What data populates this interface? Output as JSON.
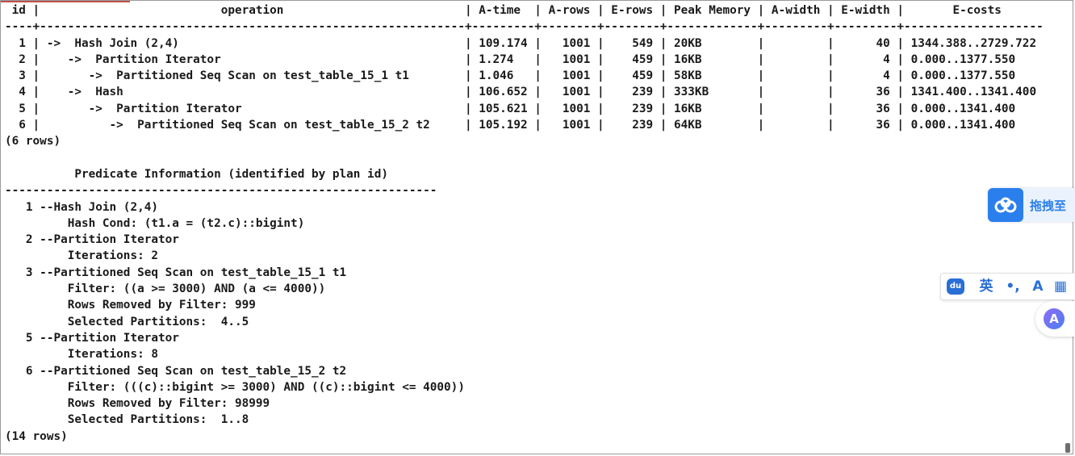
{
  "terminal": {
    "lines": [
      " id |                          operation                          | A-time  | A-rows | E-rows | Peak Memory | A-width | E-width |       E-costs",
      "----+-------------------------------------------------------------+---------+--------+--------+-------------+---------+---------+--------------------",
      "  1 | ->  Hash Join (2,4)                                         | 109.174 |   1001 |    549 | 20KB        |         |      40 | 1344.388..2729.722",
      "  2 |    ->  Partition Iterator                                   | 1.274   |   1001 |    459 | 16KB        |         |       4 | 0.000..1377.550",
      "  3 |       ->  Partitioned Seq Scan on test_table_15_1 t1        | 1.046   |   1001 |    459 | 58KB        |         |       4 | 0.000..1377.550",
      "  4 |    ->  Hash                                                 | 106.652 |   1001 |    239 | 333KB       |         |      36 | 1341.400..1341.400",
      "  5 |       ->  Partition Iterator                                | 105.621 |   1001 |    239 | 16KB        |         |      36 | 0.000..1341.400",
      "  6 |          ->  Partitioned Seq Scan on test_table_15_2 t2     | 105.192 |   1001 |    239 | 64KB        |         |      36 | 0.000..1341.400",
      "(6 rows)",
      "",
      "          Predicate Information (identified by plan id)",
      "--------------------------------------------------------------",
      "   1 --Hash Join (2,4)",
      "         Hash Cond: (t1.a = (t2.c)::bigint)",
      "   2 --Partition Iterator",
      "         Iterations: 2",
      "   3 --Partitioned Seq Scan on test_table_15_1 t1",
      "         Filter: ((a >= 3000) AND (a <= 4000))",
      "         Rows Removed by Filter: 999",
      "         Selected Partitions:  4..5",
      "   5 --Partition Iterator",
      "         Iterations: 8",
      "   6 --Partitioned Seq Scan on test_table_15_2 t2",
      "         Filter: (((c)::bigint >= 3000) AND ((c)::bigint <= 4000))",
      "         Rows Removed by Filter: 98999",
      "         Selected Partitions:  1..8",
      "(14 rows)"
    ]
  },
  "netdisk_widget": {
    "label": "拖拽至",
    "icon": "cloud-icon",
    "color": "#2b7fed"
  },
  "ime_toolbar": {
    "logo": "du",
    "language": "英",
    "punctuation": "•,",
    "font_icon": "A",
    "grid_icon": "▦"
  },
  "assistant_button": {
    "glyph": "A"
  }
}
